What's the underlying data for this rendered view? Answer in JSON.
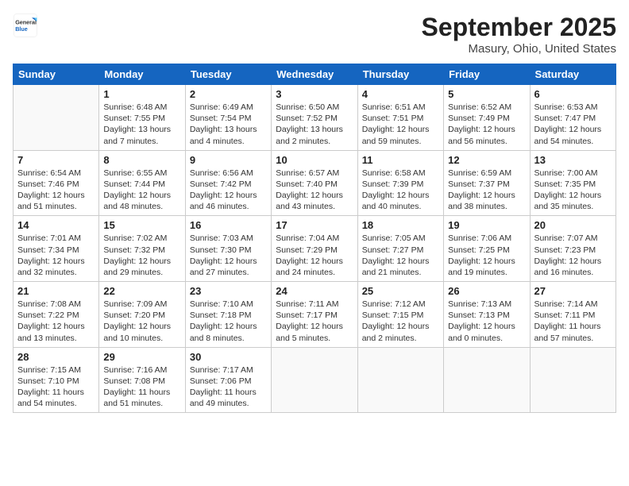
{
  "header": {
    "logo": {
      "general": "General",
      "blue": "Blue"
    },
    "title": "September 2025",
    "location": "Masury, Ohio, United States"
  },
  "weekdays": [
    "Sunday",
    "Monday",
    "Tuesday",
    "Wednesday",
    "Thursday",
    "Friday",
    "Saturday"
  ],
  "weeks": [
    [
      {
        "day": null,
        "lines": []
      },
      {
        "day": "1",
        "lines": [
          "Sunrise: 6:48 AM",
          "Sunset: 7:55 PM",
          "Daylight: 13 hours",
          "and 7 minutes."
        ]
      },
      {
        "day": "2",
        "lines": [
          "Sunrise: 6:49 AM",
          "Sunset: 7:54 PM",
          "Daylight: 13 hours",
          "and 4 minutes."
        ]
      },
      {
        "day": "3",
        "lines": [
          "Sunrise: 6:50 AM",
          "Sunset: 7:52 PM",
          "Daylight: 13 hours",
          "and 2 minutes."
        ]
      },
      {
        "day": "4",
        "lines": [
          "Sunrise: 6:51 AM",
          "Sunset: 7:51 PM",
          "Daylight: 12 hours",
          "and 59 minutes."
        ]
      },
      {
        "day": "5",
        "lines": [
          "Sunrise: 6:52 AM",
          "Sunset: 7:49 PM",
          "Daylight: 12 hours",
          "and 56 minutes."
        ]
      },
      {
        "day": "6",
        "lines": [
          "Sunrise: 6:53 AM",
          "Sunset: 7:47 PM",
          "Daylight: 12 hours",
          "and 54 minutes."
        ]
      }
    ],
    [
      {
        "day": "7",
        "lines": [
          "Sunrise: 6:54 AM",
          "Sunset: 7:46 PM",
          "Daylight: 12 hours",
          "and 51 minutes."
        ]
      },
      {
        "day": "8",
        "lines": [
          "Sunrise: 6:55 AM",
          "Sunset: 7:44 PM",
          "Daylight: 12 hours",
          "and 48 minutes."
        ]
      },
      {
        "day": "9",
        "lines": [
          "Sunrise: 6:56 AM",
          "Sunset: 7:42 PM",
          "Daylight: 12 hours",
          "and 46 minutes."
        ]
      },
      {
        "day": "10",
        "lines": [
          "Sunrise: 6:57 AM",
          "Sunset: 7:40 PM",
          "Daylight: 12 hours",
          "and 43 minutes."
        ]
      },
      {
        "day": "11",
        "lines": [
          "Sunrise: 6:58 AM",
          "Sunset: 7:39 PM",
          "Daylight: 12 hours",
          "and 40 minutes."
        ]
      },
      {
        "day": "12",
        "lines": [
          "Sunrise: 6:59 AM",
          "Sunset: 7:37 PM",
          "Daylight: 12 hours",
          "and 38 minutes."
        ]
      },
      {
        "day": "13",
        "lines": [
          "Sunrise: 7:00 AM",
          "Sunset: 7:35 PM",
          "Daylight: 12 hours",
          "and 35 minutes."
        ]
      }
    ],
    [
      {
        "day": "14",
        "lines": [
          "Sunrise: 7:01 AM",
          "Sunset: 7:34 PM",
          "Daylight: 12 hours",
          "and 32 minutes."
        ]
      },
      {
        "day": "15",
        "lines": [
          "Sunrise: 7:02 AM",
          "Sunset: 7:32 PM",
          "Daylight: 12 hours",
          "and 29 minutes."
        ]
      },
      {
        "day": "16",
        "lines": [
          "Sunrise: 7:03 AM",
          "Sunset: 7:30 PM",
          "Daylight: 12 hours",
          "and 27 minutes."
        ]
      },
      {
        "day": "17",
        "lines": [
          "Sunrise: 7:04 AM",
          "Sunset: 7:29 PM",
          "Daylight: 12 hours",
          "and 24 minutes."
        ]
      },
      {
        "day": "18",
        "lines": [
          "Sunrise: 7:05 AM",
          "Sunset: 7:27 PM",
          "Daylight: 12 hours",
          "and 21 minutes."
        ]
      },
      {
        "day": "19",
        "lines": [
          "Sunrise: 7:06 AM",
          "Sunset: 7:25 PM",
          "Daylight: 12 hours",
          "and 19 minutes."
        ]
      },
      {
        "day": "20",
        "lines": [
          "Sunrise: 7:07 AM",
          "Sunset: 7:23 PM",
          "Daylight: 12 hours",
          "and 16 minutes."
        ]
      }
    ],
    [
      {
        "day": "21",
        "lines": [
          "Sunrise: 7:08 AM",
          "Sunset: 7:22 PM",
          "Daylight: 12 hours",
          "and 13 minutes."
        ]
      },
      {
        "day": "22",
        "lines": [
          "Sunrise: 7:09 AM",
          "Sunset: 7:20 PM",
          "Daylight: 12 hours",
          "and 10 minutes."
        ]
      },
      {
        "day": "23",
        "lines": [
          "Sunrise: 7:10 AM",
          "Sunset: 7:18 PM",
          "Daylight: 12 hours",
          "and 8 minutes."
        ]
      },
      {
        "day": "24",
        "lines": [
          "Sunrise: 7:11 AM",
          "Sunset: 7:17 PM",
          "Daylight: 12 hours",
          "and 5 minutes."
        ]
      },
      {
        "day": "25",
        "lines": [
          "Sunrise: 7:12 AM",
          "Sunset: 7:15 PM",
          "Daylight: 12 hours",
          "and 2 minutes."
        ]
      },
      {
        "day": "26",
        "lines": [
          "Sunrise: 7:13 AM",
          "Sunset: 7:13 PM",
          "Daylight: 12 hours",
          "and 0 minutes."
        ]
      },
      {
        "day": "27",
        "lines": [
          "Sunrise: 7:14 AM",
          "Sunset: 7:11 PM",
          "Daylight: 11 hours",
          "and 57 minutes."
        ]
      }
    ],
    [
      {
        "day": "28",
        "lines": [
          "Sunrise: 7:15 AM",
          "Sunset: 7:10 PM",
          "Daylight: 11 hours",
          "and 54 minutes."
        ]
      },
      {
        "day": "29",
        "lines": [
          "Sunrise: 7:16 AM",
          "Sunset: 7:08 PM",
          "Daylight: 11 hours",
          "and 51 minutes."
        ]
      },
      {
        "day": "30",
        "lines": [
          "Sunrise: 7:17 AM",
          "Sunset: 7:06 PM",
          "Daylight: 11 hours",
          "and 49 minutes."
        ]
      },
      {
        "day": null,
        "lines": []
      },
      {
        "day": null,
        "lines": []
      },
      {
        "day": null,
        "lines": []
      },
      {
        "day": null,
        "lines": []
      }
    ]
  ]
}
